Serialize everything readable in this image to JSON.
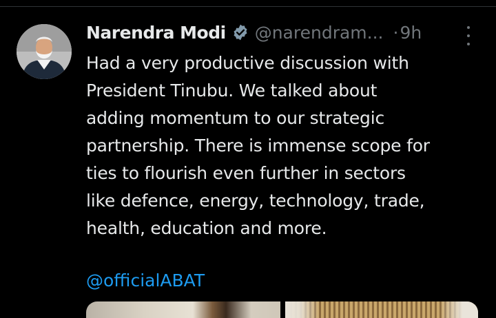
{
  "tweet": {
    "author_name": "Narendra Modi",
    "verified_icon": "verified-badge-icon",
    "handle": "@narendram...",
    "separator": "·",
    "time": "9h",
    "more_icon": "more-vertical-icon",
    "body": "Had a very productive discussion with\nPresident Tinubu. We talked about\nadding momentum to our strategic\npartnership. There is immense scope for\nties to flourish even further in sectors\nlike defence, energy, technology, trade,\nhealth, education and more.",
    "mention": "@officialABAT"
  },
  "colors": {
    "background": "#000000",
    "text_primary": "#e7e9ea",
    "text_secondary": "#71767b",
    "link": "#1d9bf0",
    "divider": "#2f3336"
  }
}
